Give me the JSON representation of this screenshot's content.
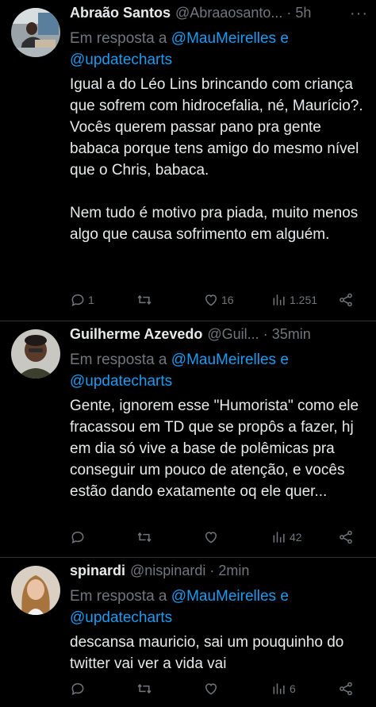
{
  "tweets": [
    {
      "name": "Abraão Santos",
      "handle": "@Abraaosanto...",
      "time": "5h",
      "reply_prefix": "Em resposta a ",
      "reply_mention1": "@MauMeirelles",
      "reply_and": " e",
      "reply_mention2": "@updatecharts",
      "text": "Igual a do Léo Lins brincando com criança que sofrem com hidrocefalia, né, Maurício?. Vocês querem passar pano pra gente babaca porque tens amigo do mesmo nível que o Chris, babaca.\n\nNem tudo é motivo pra piada, muito menos algo que causa sofrimento em alguém.",
      "replies": "1",
      "retweets": "",
      "likes": "16",
      "views": "1.251"
    },
    {
      "name": "Guilherme Azevedo",
      "handle": "@Guil...",
      "time": "35min",
      "reply_prefix": "Em resposta a ",
      "reply_mention1": "@MauMeirelles",
      "reply_and": " e",
      "reply_mention2": "@updatecharts",
      "text": "Gente, ignorem esse \"Humorista\" como ele fracassou em TD que se propôs a fazer, hj em dia só vive a base de polêmicas pra conseguir um pouco de atenção, e vocês estão dando exatamente oq ele quer...",
      "replies": "",
      "retweets": "",
      "likes": "",
      "views": "42"
    },
    {
      "name": "spinardi",
      "handle": "@nispinardi",
      "time": "2min",
      "reply_prefix": "Em resposta a ",
      "reply_mention1": "@MauMeirelles",
      "reply_and": " e",
      "reply_mention2": "@updatecharts",
      "text": "descansa mauricio, sai um pouquinho do twitter vai ver a vida vai",
      "replies": "",
      "retweets": "",
      "likes": "",
      "views": "6"
    }
  ],
  "more_glyph": "···",
  "dot_glyph": "·",
  "icons": [
    "reply-icon",
    "retweet-icon",
    "like-icon",
    "views-icon",
    "share-icon"
  ],
  "colors": {
    "background": "#000000",
    "text": "#e7e9ea",
    "muted": "#71767b",
    "link": "#1d9bf0",
    "divider": "#2f3336"
  }
}
